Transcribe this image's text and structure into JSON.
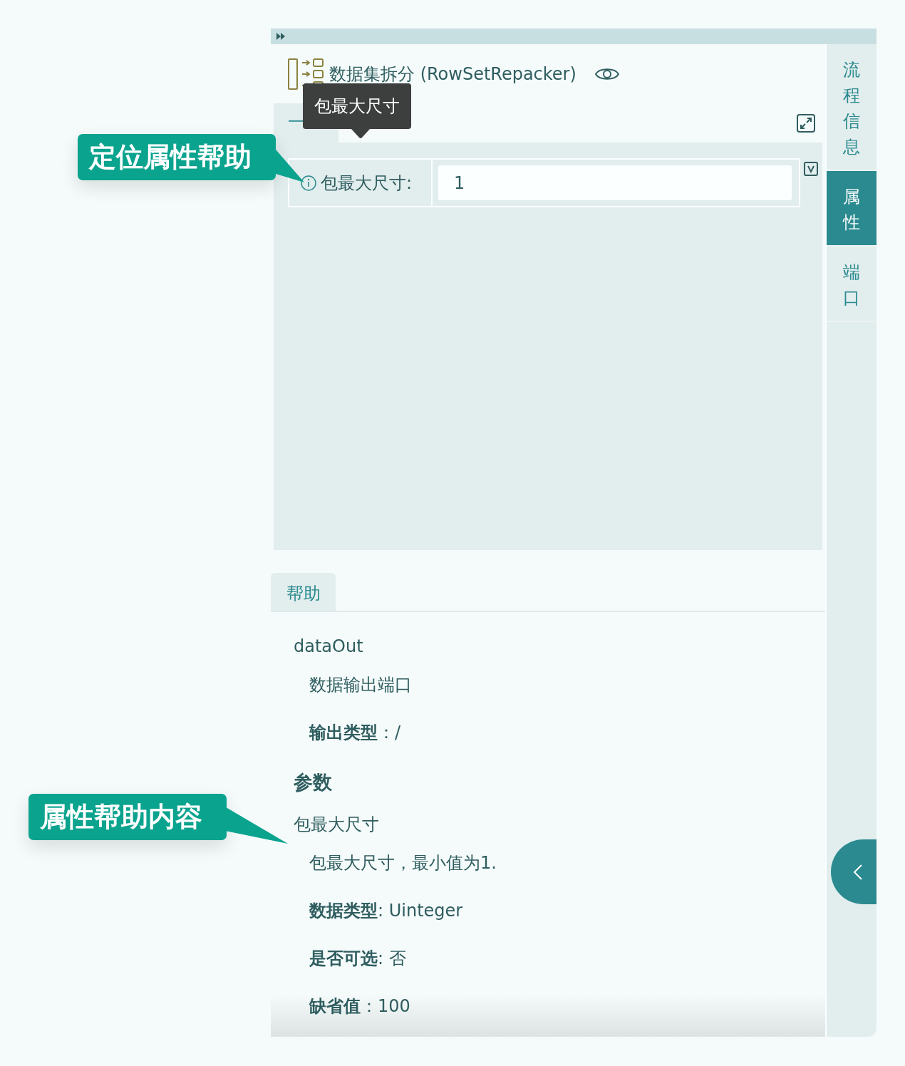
{
  "header": {
    "title": "数据集拆分 (RowSetRepacker)"
  },
  "tabs": [
    {
      "label": "一",
      "selected": true
    }
  ],
  "tooltip": {
    "text": "包最大尺寸"
  },
  "properties": [
    {
      "label": "包最大尺寸:",
      "value": "1"
    }
  ],
  "side_tabs": [
    {
      "label": "流程信息",
      "selected": false
    },
    {
      "label": "属性",
      "selected": true
    },
    {
      "label": "端口",
      "selected": false
    }
  ],
  "help": {
    "tab": "帮助",
    "items": [
      {
        "kind": "name",
        "text": "dataOut"
      },
      {
        "kind": "desc",
        "text": "数据输出端口"
      },
      {
        "kind": "field",
        "text": "**输出类型**：/"
      },
      {
        "kind": "heading",
        "text": "**参数**"
      },
      {
        "kind": "name",
        "text": "包最大尺寸"
      },
      {
        "kind": "desc",
        "text": "包最大尺寸，最小值为1."
      },
      {
        "kind": "field",
        "text": "**数据类型**: Uinteger"
      },
      {
        "kind": "field",
        "text": "**是否可选**: 否"
      },
      {
        "kind": "field",
        "text": "**缺省值**：100"
      }
    ]
  },
  "callouts": [
    {
      "text": "定位属性帮助"
    },
    {
      "text": "属性帮助内容"
    }
  ]
}
